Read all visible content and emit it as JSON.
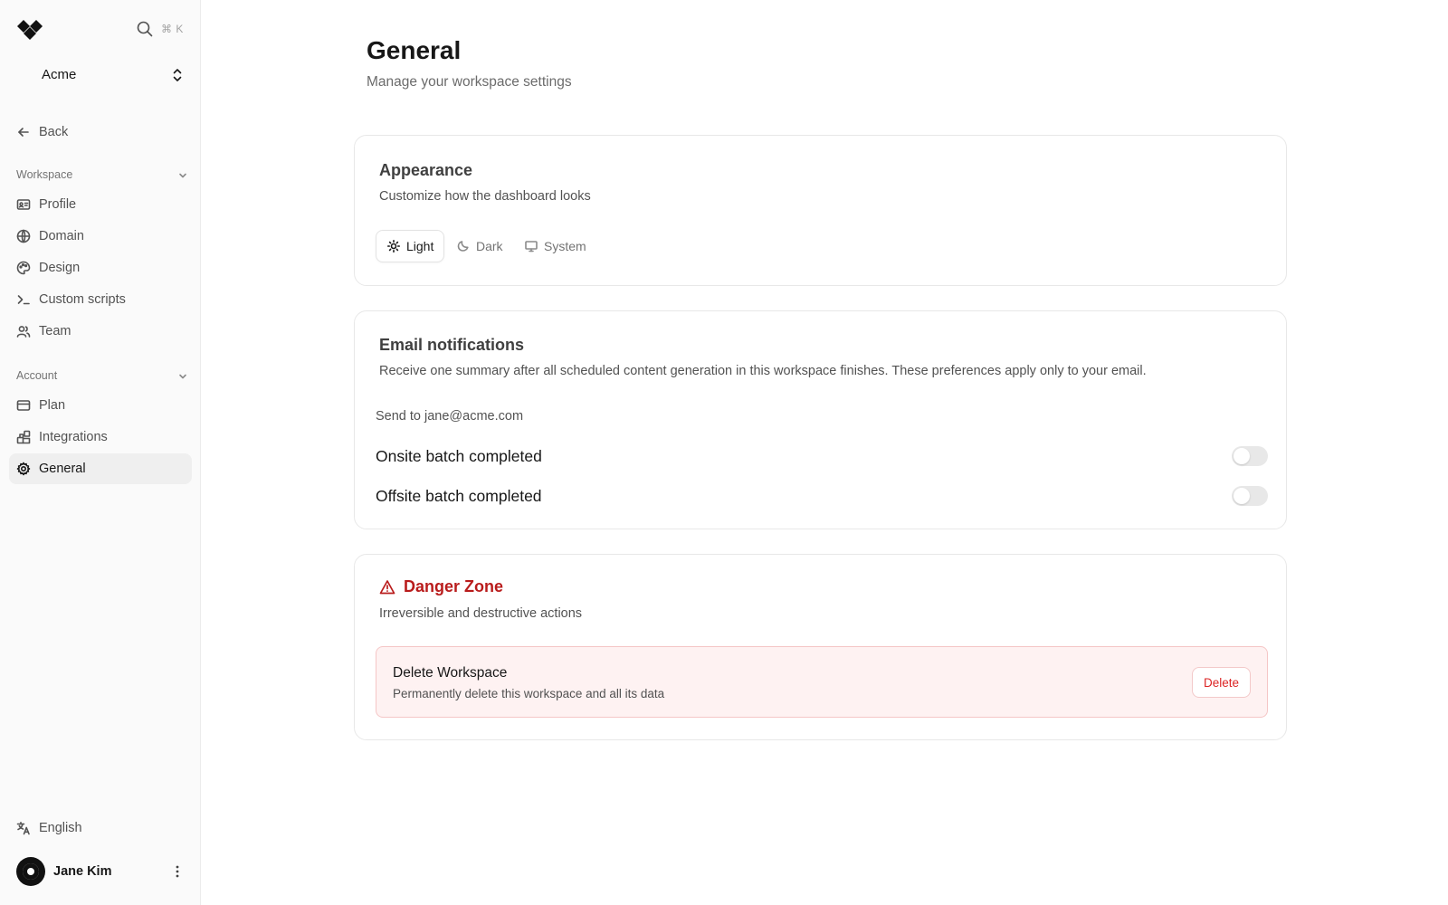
{
  "sidebar": {
    "search_shortcut": "⌘ K",
    "workspace_name": "Acme",
    "back_label": "Back",
    "groups": [
      {
        "label": "Workspace",
        "items": [
          {
            "label": "Profile",
            "icon": "id-card-icon"
          },
          {
            "label": "Domain",
            "icon": "globe-icon"
          },
          {
            "label": "Design",
            "icon": "palette-icon"
          },
          {
            "label": "Custom scripts",
            "icon": "terminal-icon"
          },
          {
            "label": "Team",
            "icon": "users-icon"
          }
        ]
      },
      {
        "label": "Account",
        "items": [
          {
            "label": "Plan",
            "icon": "credit-card-icon"
          },
          {
            "label": "Integrations",
            "icon": "blocks-icon"
          },
          {
            "label": "General",
            "icon": "gear-icon",
            "active": true
          }
        ]
      }
    ],
    "language": "English",
    "user_name": "Jane Kim"
  },
  "main": {
    "title": "General",
    "subtitle": "Manage your workspace settings",
    "appearance": {
      "title": "Appearance",
      "description": "Customize how the dashboard looks",
      "options": [
        {
          "label": "Light",
          "icon": "sun-icon",
          "selected": true
        },
        {
          "label": "Dark",
          "icon": "moon-icon",
          "selected": false
        },
        {
          "label": "System",
          "icon": "monitor-icon",
          "selected": false
        }
      ]
    },
    "email": {
      "title": "Email notifications",
      "description": "Receive one summary after all scheduled content generation in this workspace finishes. These preferences apply only to your email.",
      "send_to": "Send to jane@acme.com",
      "toggles": [
        {
          "label": "Onsite batch completed",
          "on": false
        },
        {
          "label": "Offsite batch completed",
          "on": false
        }
      ]
    },
    "danger": {
      "title": "Danger Zone",
      "description": "Irreversible and destructive actions",
      "item_title": "Delete Workspace",
      "item_description": "Permanently delete this workspace and all its data",
      "button_label": "Delete"
    }
  },
  "colors": {
    "danger": "#b91c1c",
    "danger_bg": "#fef2f2",
    "sidebar_bg": "#fafafa",
    "active_item_bg": "#efefef"
  }
}
